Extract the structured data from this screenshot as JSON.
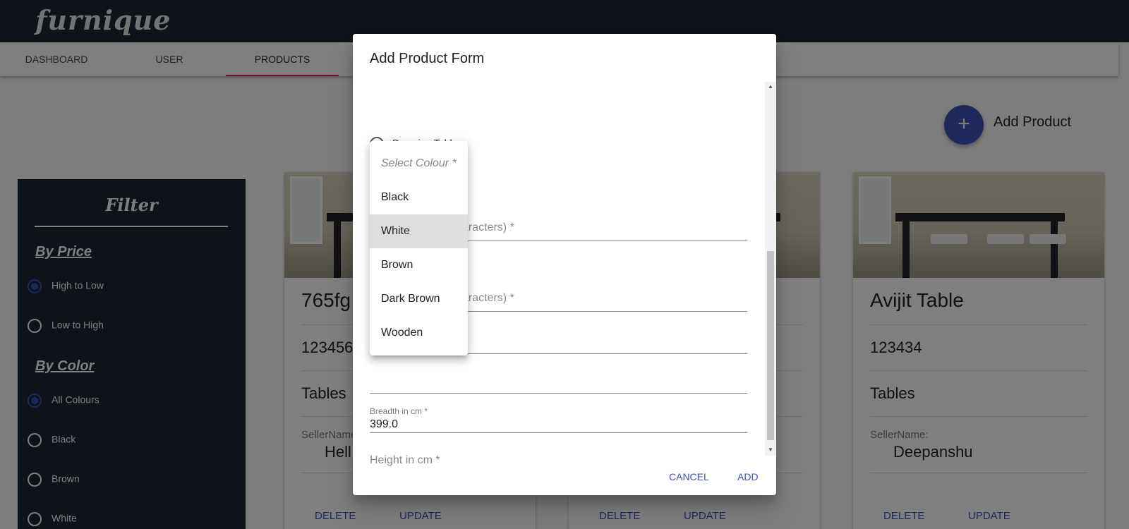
{
  "app": {
    "logo": "furnique"
  },
  "nav": {
    "tabs": [
      "DASHBOARD",
      "USER",
      "PRODUCTS"
    ],
    "active_tab": "PRODUCTS"
  },
  "add_product": {
    "icon": "plus-icon",
    "label": "Add Product"
  },
  "filter": {
    "title": "Filter",
    "price_heading": "By Price",
    "price_options": [
      "High to Low",
      "Low to High"
    ],
    "color_heading": "By Color",
    "color_options": [
      "All Colours",
      "Black",
      "Brown",
      "White"
    ]
  },
  "cards": [
    {
      "title": "765fg",
      "number": "123456",
      "category": "Tables",
      "seller_label": "SellerName:",
      "seller": "Hell",
      "delete": "DELETE",
      "update": "UPDATE"
    },
    {
      "title": "",
      "number": "",
      "category": "",
      "seller_label": "",
      "seller": "",
      "delete": "DELETE",
      "update": "UPDATE"
    },
    {
      "title": "Avijit Table",
      "number": "123434",
      "category": "Tables",
      "seller_label": "SellerName:",
      "seller": "Deepanshu",
      "delete": "DELETE",
      "update": "UPDATE"
    }
  ],
  "dialog": {
    "title": "Add Product Form",
    "type_option": "Dressing Table",
    "field1_placeholder": "aracters) *",
    "field2_placeholder": "aracters) *",
    "breadth_label": "Breadth in cm *",
    "breadth_value": "399.0",
    "height_placeholder": "Height in cm *",
    "cancel": "CANCEL",
    "add": "ADD"
  },
  "colour_menu": {
    "placeholder": "Select Colour *",
    "options": [
      "Black",
      "White",
      "Brown",
      "Dark Brown",
      "Wooden"
    ],
    "highlighted": "White"
  },
  "colors": {
    "appbar": "#1c2533",
    "primary": "#3f51b5",
    "tab_indicator": "#e91e63"
  }
}
